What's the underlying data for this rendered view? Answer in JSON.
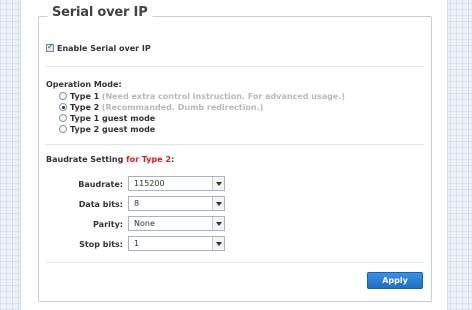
{
  "section": {
    "title": "Serial over IP",
    "enable_label": "Enable Serial over IP",
    "enable_checked": true
  },
  "operation_mode": {
    "label": "Operation Mode:",
    "options": [
      {
        "name": "Type 1",
        "hint": "(Need extra control instruction. For advanced usage.)",
        "selected": false
      },
      {
        "name": "Type 2",
        "hint": "(Recommanded. Dumb redirection.)",
        "selected": true
      },
      {
        "name": "Type 1 guest mode",
        "hint": "",
        "selected": false
      },
      {
        "name": "Type 2 guest mode",
        "hint": "",
        "selected": false
      }
    ]
  },
  "baudrate_setting": {
    "label_prefix": "Baudrate Setting",
    "label_highlight": "for Type 2",
    "label_suffix": ":",
    "highlight_color": "#e01b1b",
    "fields": [
      {
        "label": "Baudrate:",
        "value": "115200"
      },
      {
        "label": "Data bits:",
        "value": "8"
      },
      {
        "label": "Parity:",
        "value": "None"
      },
      {
        "label": "Stop bits:",
        "value": "1"
      }
    ]
  },
  "actions": {
    "apply_label": "Apply",
    "apply_color": "#2a7fd4"
  }
}
